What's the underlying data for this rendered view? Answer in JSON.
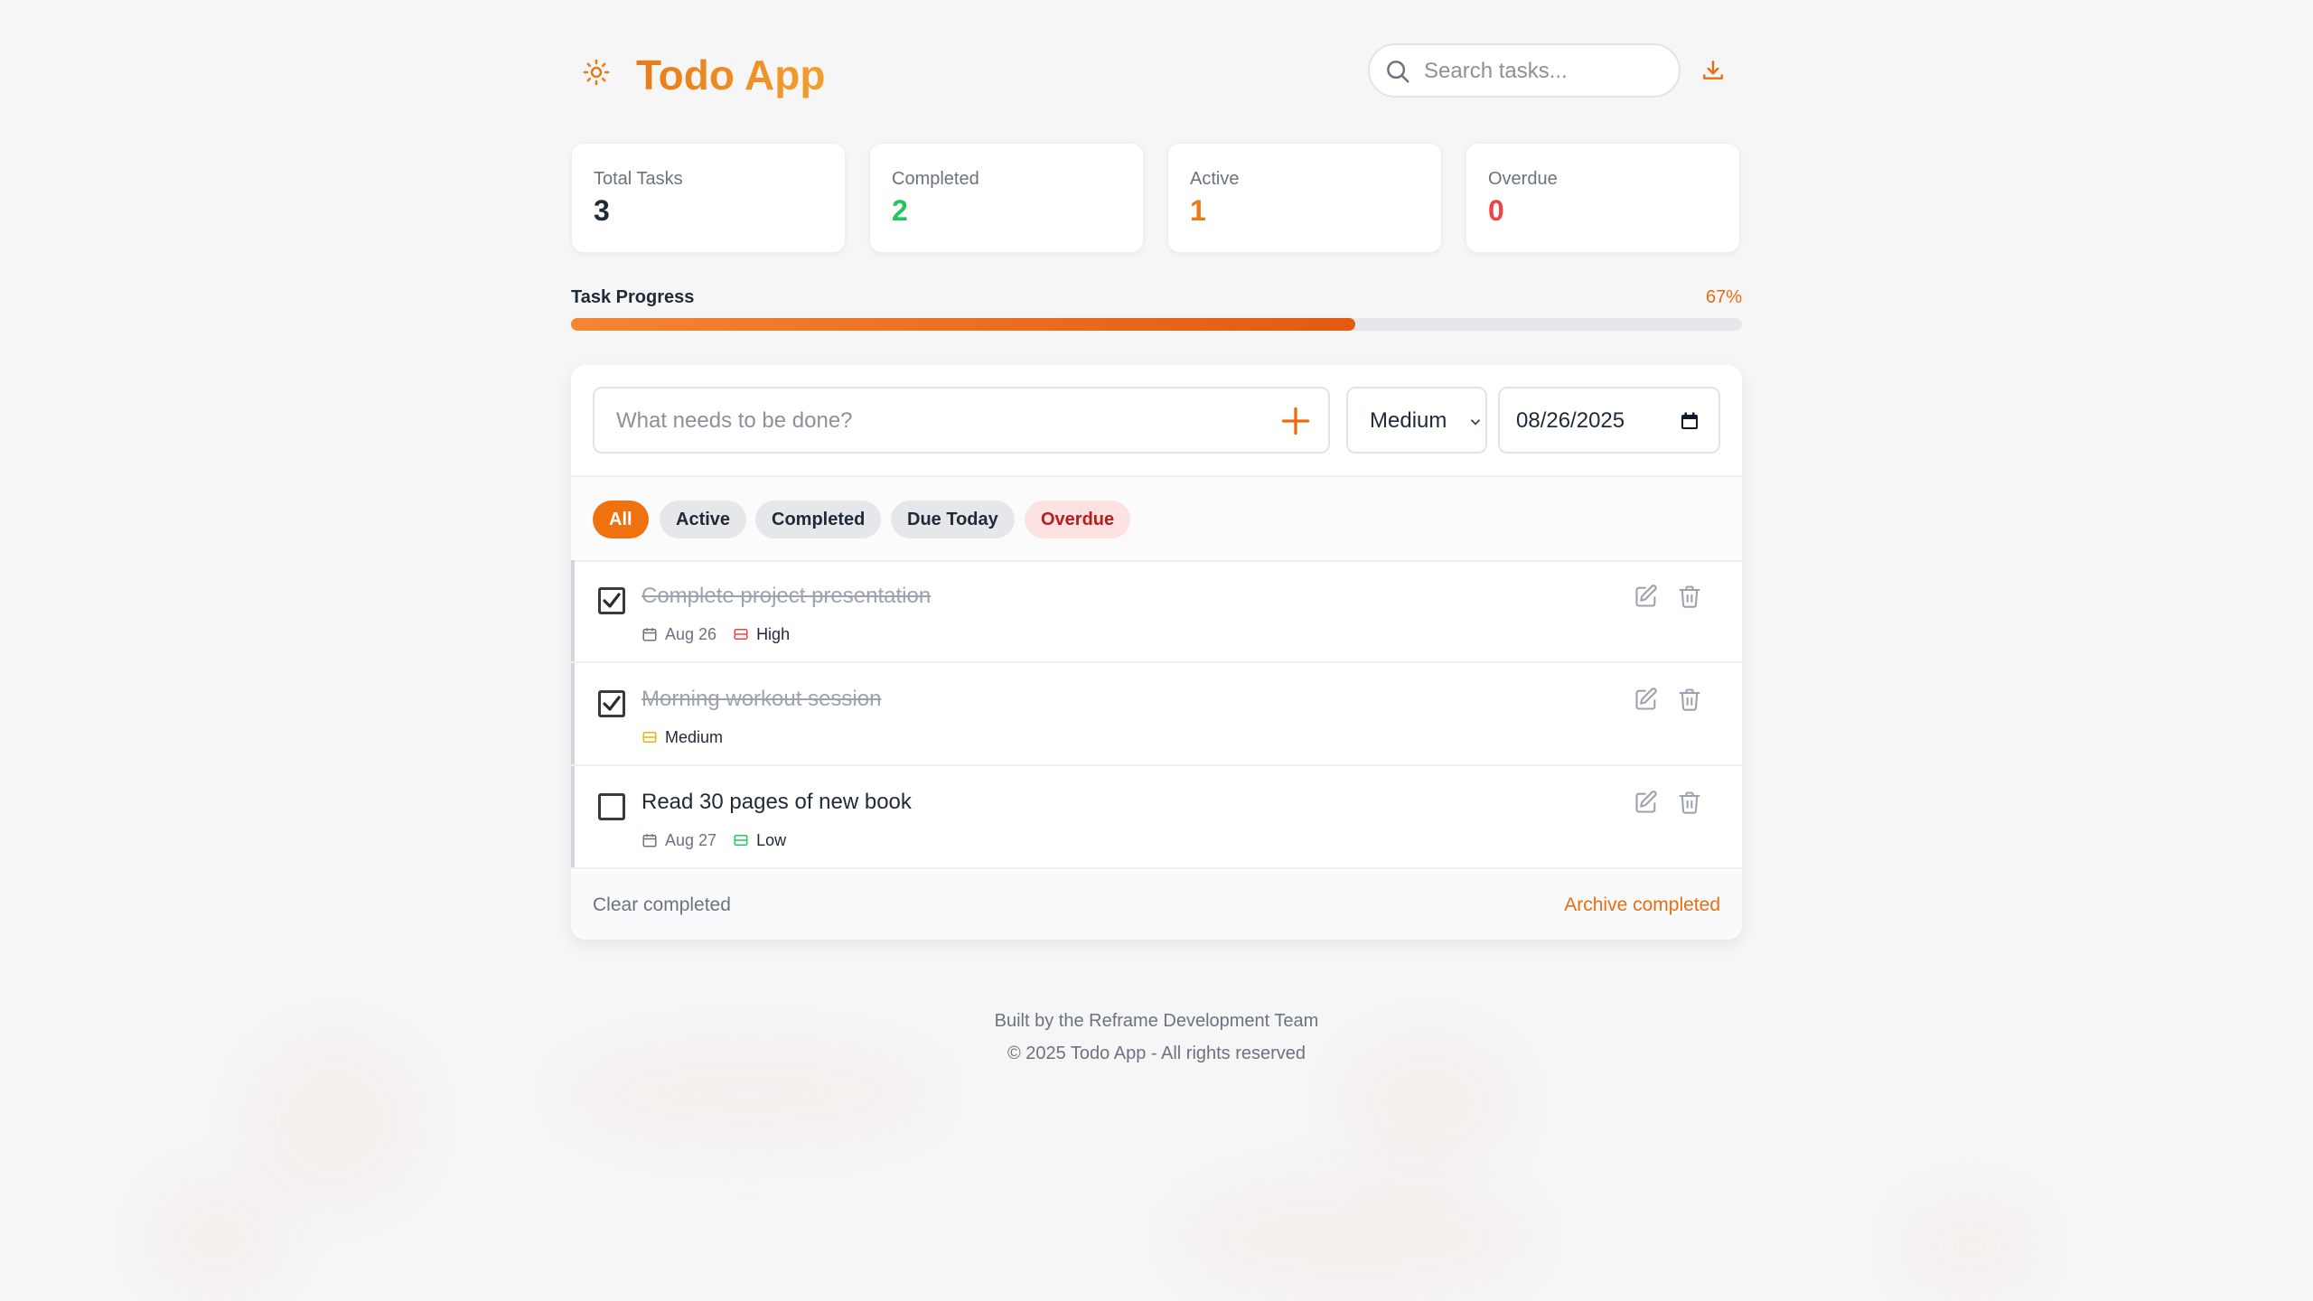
{
  "app": {
    "title": "Todo App",
    "accent_color": "#ea7a18",
    "theme_icon": "sun-icon",
    "download_icon": "download-icon"
  },
  "search": {
    "placeholder": "Search tasks...",
    "value": "",
    "icon": "search-icon"
  },
  "stats": [
    {
      "label": "Total Tasks",
      "value": "3",
      "color": "#1f2937"
    },
    {
      "label": "Completed",
      "value": "2",
      "color": "#22c55e"
    },
    {
      "label": "Active",
      "value": "1",
      "color": "#ea7a18"
    },
    {
      "label": "Overdue",
      "value": "0",
      "color": "#ef4444"
    }
  ],
  "progress": {
    "label": "Task Progress",
    "percent_text": "67%",
    "fraction": 0.67
  },
  "add_task": {
    "placeholder": "What needs to be done?",
    "value": "",
    "priority": "Medium",
    "date": "08/26/2025",
    "add_icon": "plus-icon",
    "calendar_icon": "calendar-icon"
  },
  "filters": [
    {
      "label": "All",
      "active": true
    },
    {
      "label": "Active",
      "active": false
    },
    {
      "label": "Completed",
      "active": false
    },
    {
      "label": "Due Today",
      "active": false
    },
    {
      "label": "Overdue",
      "active": false,
      "danger": true
    }
  ],
  "tasks": [
    {
      "title": "Complete project presentation",
      "completed": true,
      "date": "Aug 26",
      "priority": "High",
      "priority_color": "#ef4444"
    },
    {
      "title": "Morning workout session",
      "completed": true,
      "date": "",
      "priority": "Medium",
      "priority_color": "#eab308"
    },
    {
      "title": "Read 30 pages of new book",
      "completed": false,
      "date": "Aug 27",
      "priority": "Low",
      "priority_color": "#22c55e"
    }
  ],
  "actions": {
    "clear_completed": "Clear completed",
    "archive_completed": "Archive completed"
  },
  "footer": {
    "line1": "Built by the Reframe Development Team",
    "line2": "© 2025 Todo App - All rights reserved"
  }
}
